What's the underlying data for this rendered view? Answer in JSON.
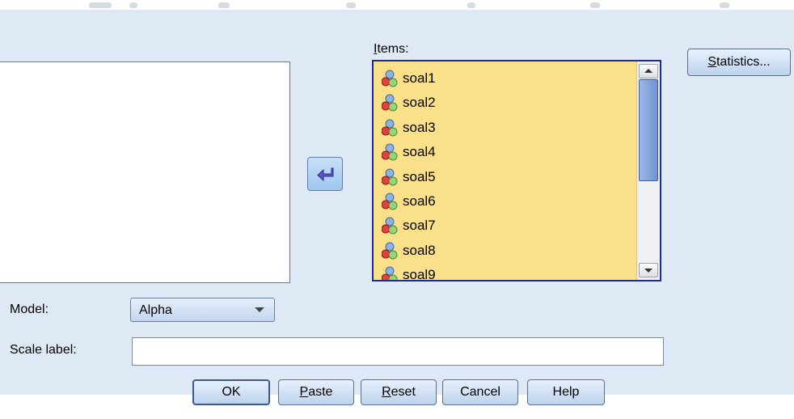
{
  "dialog": {
    "items_label": "Items:",
    "items": [
      "soal1",
      "soal2",
      "soal3",
      "soal4",
      "soal5",
      "soal6",
      "soal7",
      "soal8",
      "soal9"
    ],
    "statistics_button": "Statistics...",
    "model_label": "Model:",
    "model_value": "Alpha",
    "scale_label_label": "Scale label:",
    "scale_label_value": ""
  },
  "buttons": {
    "ok": "OK",
    "paste": "Paste",
    "reset": "Reset",
    "cancel": "Cancel",
    "help": "Help"
  },
  "colors": {
    "dialog_bg": "#dfe9f6",
    "items_bg": "#fbe08a",
    "selection_border": "#1d2d8a"
  },
  "icons": {
    "variable": "scale-variable-icon",
    "move": "move-arrow-icon"
  }
}
